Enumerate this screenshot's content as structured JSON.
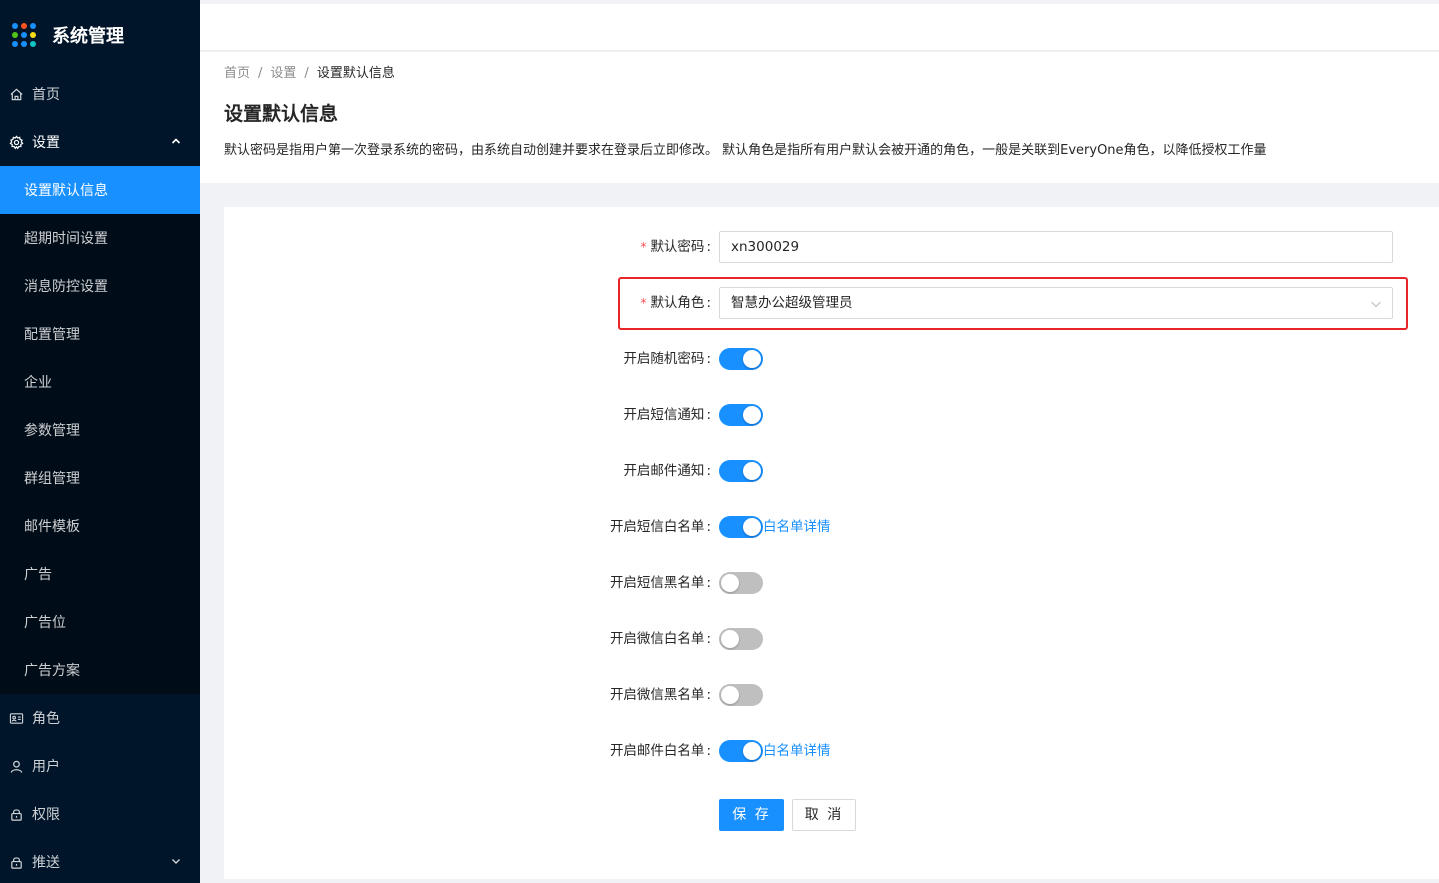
{
  "app": {
    "title": "系统管理"
  },
  "sidebar": {
    "items": [
      {
        "label": "首页",
        "icon": "home-icon"
      },
      {
        "label": "设置",
        "icon": "gear-icon",
        "expanded": true
      },
      {
        "label": "角色",
        "icon": "id-card-icon"
      },
      {
        "label": "用户",
        "icon": "user-icon"
      },
      {
        "label": "权限",
        "icon": "lock-icon"
      },
      {
        "label": "推送",
        "icon": "lock-icon"
      }
    ],
    "submenu": [
      {
        "label": "设置默认信息",
        "active": true
      },
      {
        "label": "超期时间设置"
      },
      {
        "label": "消息防控设置"
      },
      {
        "label": "配置管理"
      },
      {
        "label": "企业"
      },
      {
        "label": "参数管理"
      },
      {
        "label": "群组管理"
      },
      {
        "label": "邮件模板"
      },
      {
        "label": "广告"
      },
      {
        "label": "广告位"
      },
      {
        "label": "广告方案"
      }
    ]
  },
  "breadcrumb": {
    "home": "首页",
    "settings": "设置",
    "current": "设置默认信息",
    "separator": "/"
  },
  "page": {
    "title": "设置默认信息",
    "description": "默认密码是指用户第一次登录系统的密码，由系统自动创建并要求在登录后立即修改。 默认角色是指所有用户默认会被开通的角色，一般是关联到EveryOne角色，以降低授权工作量"
  },
  "form": {
    "required_mark": "*",
    "colon": ":",
    "password": {
      "label": "默认密码",
      "value": "xn300029"
    },
    "role": {
      "label": "默认角色",
      "value": "智慧办公超级管理员"
    },
    "random_password": {
      "label": "开启随机密码",
      "on": true
    },
    "sms_notify": {
      "label": "开启短信通知",
      "on": true
    },
    "mail_notify": {
      "label": "开启邮件通知",
      "on": true
    },
    "sms_whitelist": {
      "label": "开启短信白名单",
      "on": true,
      "link": "白名单详情"
    },
    "sms_blacklist": {
      "label": "开启短信黑名单",
      "on": false
    },
    "wechat_whitelist": {
      "label": "开启微信白名单",
      "on": false
    },
    "wechat_blacklist": {
      "label": "开启微信黑名单",
      "on": false
    },
    "mail_whitelist": {
      "label": "开启邮件白名单",
      "on": true,
      "link": "白名单详情"
    },
    "save_label": "保 存",
    "cancel_label": "取 消"
  },
  "colors": {
    "primary": "#1890ff",
    "sidebar_bg": "#001529",
    "highlight": "#e8262a"
  }
}
